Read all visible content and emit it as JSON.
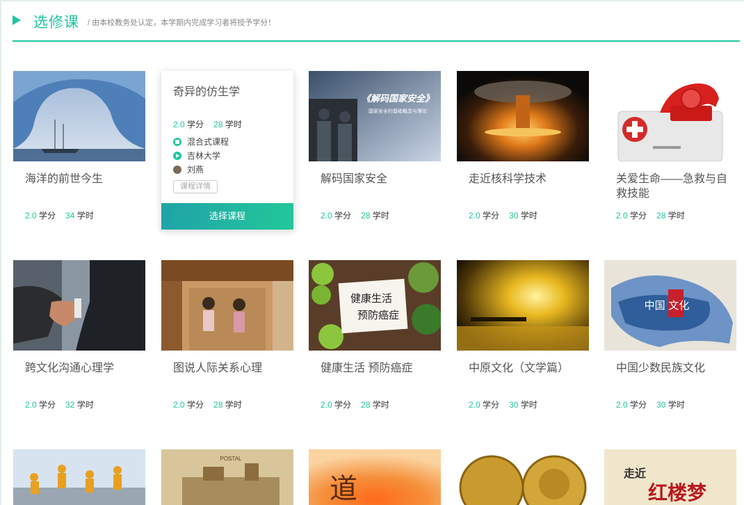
{
  "header": {
    "title": "选修课",
    "subtitle": "/ 由本校教务处认定，本学期内完成学习者将授予学分！"
  },
  "labels": {
    "credit_unit": "学分",
    "hour_unit": "学时"
  },
  "colors": {
    "accent": "#20c4a0"
  },
  "courses": [
    {
      "name": "海洋的前世今生",
      "credit": "2.0",
      "hours": "34"
    },
    {
      "name": "奇异的仿生学",
      "credit": "2.0",
      "hours": "28"
    },
    {
      "name": "解码国家安全",
      "credit": "2.0",
      "hours": "28"
    },
    {
      "name": "走近核科学技术",
      "credit": "2.0",
      "hours": "30"
    },
    {
      "name": "关爱生命——急救与自救技能",
      "credit": "2.0",
      "hours": "28"
    },
    {
      "name": "跨文化沟通心理学",
      "credit": "2.0",
      "hours": "32"
    },
    {
      "name": "图说人际关系心理",
      "credit": "2.0",
      "hours": "28"
    },
    {
      "name": "健康生活 预防癌症",
      "credit": "2.0",
      "hours": "28"
    },
    {
      "name": "中原文化（文学篇）",
      "credit": "2.0",
      "hours": "30"
    },
    {
      "name": "中国少数民族文化",
      "credit": "2.0",
      "hours": "30"
    }
  ],
  "hover_card": {
    "type": "混合式课程",
    "school": "吉林大学",
    "teacher": "刘燕",
    "detail_button": "课程详情",
    "select_button": "选择课程"
  },
  "image_texts": {
    "security_title": "《解码国家安全》",
    "security_sub": "国家安全的基础概念与理论",
    "health_line1": "健康生活",
    "health_line2": "预防癌症",
    "ethnic_text": "中国 文化",
    "dream_line1": "走近",
    "dream_line2": "红楼梦",
    "dao_char": "道",
    "palace_sign": "POSTAL"
  }
}
